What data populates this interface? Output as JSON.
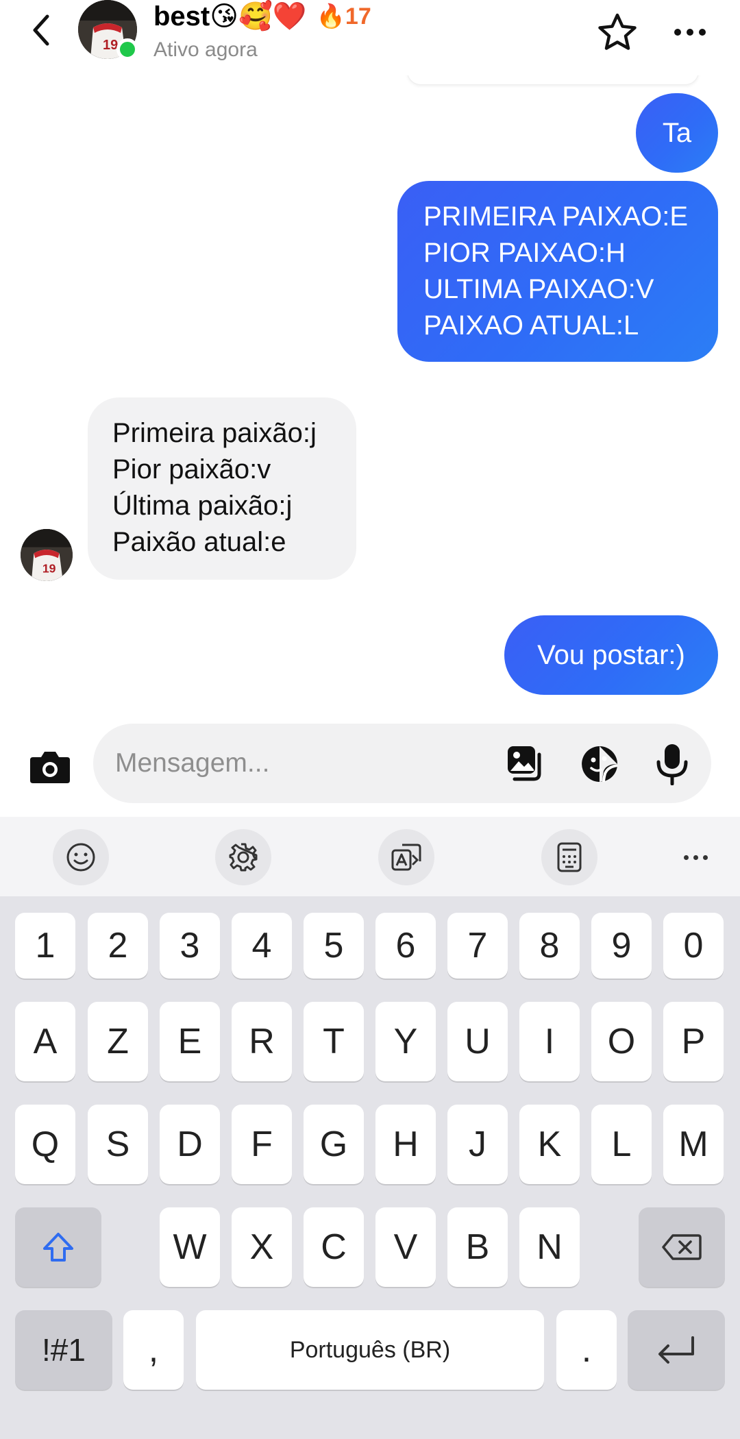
{
  "header": {
    "name": "best😘🥰❤️",
    "streak_icon": "🔥",
    "streak_count": "17",
    "status": "Ativo agora"
  },
  "messages": [
    {
      "direction": "out",
      "text": "Ta"
    },
    {
      "direction": "out",
      "text": "PRIMEIRA PAIXAO:E\nPIOR PAIXAO:H\nULTIMA PAIXAO:V\nPAIXAO ATUAL:L"
    },
    {
      "direction": "in",
      "text": "Primeira paixão:j\nPior paixão:v\nÚltima paixão:j\nPaixão atual:e"
    },
    {
      "direction": "out",
      "text": "Vou postar:)"
    }
  ],
  "composer": {
    "placeholder": "Mensagem...",
    "value": ""
  },
  "keyboard": {
    "rows": [
      [
        "1",
        "2",
        "3",
        "4",
        "5",
        "6",
        "7",
        "8",
        "9",
        "0"
      ],
      [
        "A",
        "Z",
        "E",
        "R",
        "T",
        "Y",
        "U",
        "I",
        "O",
        "P"
      ],
      [
        "Q",
        "S",
        "D",
        "F",
        "G",
        "H",
        "J",
        "K",
        "L",
        "M"
      ],
      [
        "W",
        "X",
        "C",
        "V",
        "B",
        "N"
      ]
    ],
    "symbols_label": "!#1",
    "comma_label": ",",
    "space_label": "Português (BR)",
    "period_label": "."
  },
  "colors": {
    "outgoing_bubble": "#2d6ff3",
    "incoming_bubble": "#f2f2f3",
    "online_dot": "#1fc84a",
    "streak": "#f0682a"
  }
}
